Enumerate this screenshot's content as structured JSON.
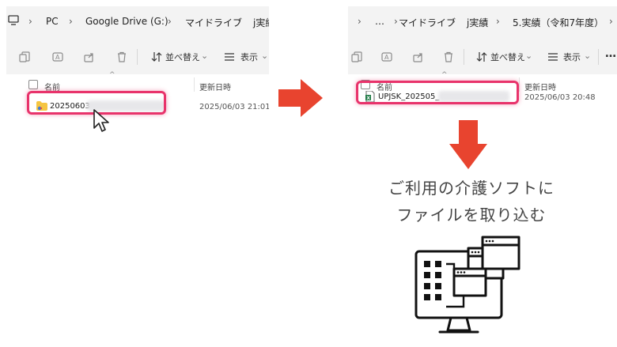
{
  "left_explorer": {
    "breadcrumb": [
      "PC",
      "Google Drive (G:)",
      "マイドライブ",
      "j実績"
    ],
    "toolbar": {
      "sort_label": "並べ替え",
      "view_label": "表示"
    },
    "columns": {
      "name": "名前",
      "modified": "更新日時"
    },
    "file": {
      "name": "20250603",
      "modified": "2025/06/03 21:01"
    }
  },
  "right_explorer": {
    "breadcrumb": [
      "…",
      "マイドライブ",
      "j実績",
      "5.実績（令和7年度）"
    ],
    "toolbar": {
      "sort_label": "並べ替え",
      "view_label": "表示",
      "more_label": "…"
    },
    "columns": {
      "name": "名前",
      "modified": "更新日時"
    },
    "file": {
      "name": "UPJSK_202505_",
      "modified": "2025/06/03 20:48"
    }
  },
  "caption": {
    "line1": "ご利用の介護ソフトに",
    "line2": "ファイルを取り込む"
  },
  "colors": {
    "highlight": "#e8336b",
    "arrow": "#e8442f"
  },
  "icons": [
    "folder-icon",
    "excel-file-icon",
    "mouse-cursor-icon",
    "computer-import-icon"
  ]
}
